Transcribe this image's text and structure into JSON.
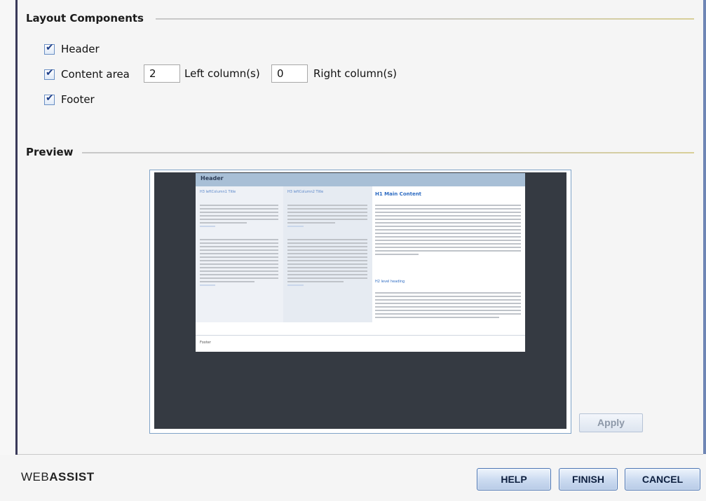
{
  "layout_section": {
    "title": "Layout Components",
    "header": {
      "label": "Header",
      "checked": true
    },
    "content_area": {
      "label": "Content area",
      "checked": true,
      "left_columns_value": "2",
      "left_columns_label": "Left column(s)",
      "right_columns_value": "0",
      "right_columns_label": "Right column(s)"
    },
    "footer": {
      "label": "Footer",
      "checked": true
    }
  },
  "preview_section": {
    "title": "Preview",
    "page": {
      "header": "Header",
      "left_col1_title": "H3 leftColumn1 Title",
      "left_col2_title": "H3 leftColumn2 Title",
      "main_title": "H1 Main Content",
      "h2": "H2 level heading",
      "footer": "Footer"
    },
    "apply_label": "Apply"
  },
  "footer": {
    "logo_prefix": "WEB",
    "logo_suffix": "ASSIST",
    "help_label": "HELP",
    "finish_label": "FINISH",
    "cancel_label": "CANCEL"
  },
  "colors": {
    "button_border": "#4c76b4",
    "preview_bg": "#353a42",
    "header_band": "#a8bfd6",
    "link_blue": "#2d6bc2"
  }
}
